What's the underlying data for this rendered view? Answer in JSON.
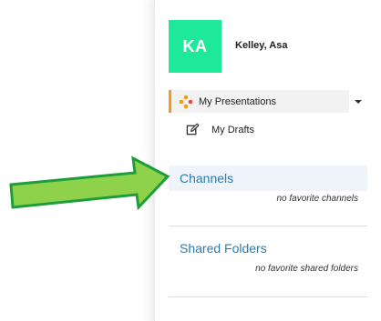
{
  "user": {
    "initials": "KA",
    "name": "Kelley, Asa",
    "avatar_color": "#1ee89a"
  },
  "nav": {
    "items": [
      {
        "label": "My Presentations",
        "icon": "presentation-dots-icon",
        "active": true
      },
      {
        "label": "My Drafts",
        "icon": "edit-icon",
        "active": false
      }
    ],
    "active_accent": "#f39c12"
  },
  "sections": {
    "channels": {
      "title": "Channels",
      "empty_text": "no favorite channels"
    },
    "shared_folders": {
      "title": "Shared Folders",
      "empty_text": "no favorite shared folders"
    }
  },
  "annotation": {
    "arrow_icon": "green-arrow-icon",
    "arrow_color": "#8ed14b",
    "arrow_border": "#1e9e3a"
  },
  "colors": {
    "link_blue": "#2b7bb0",
    "section_highlight": "#eef4f9"
  }
}
